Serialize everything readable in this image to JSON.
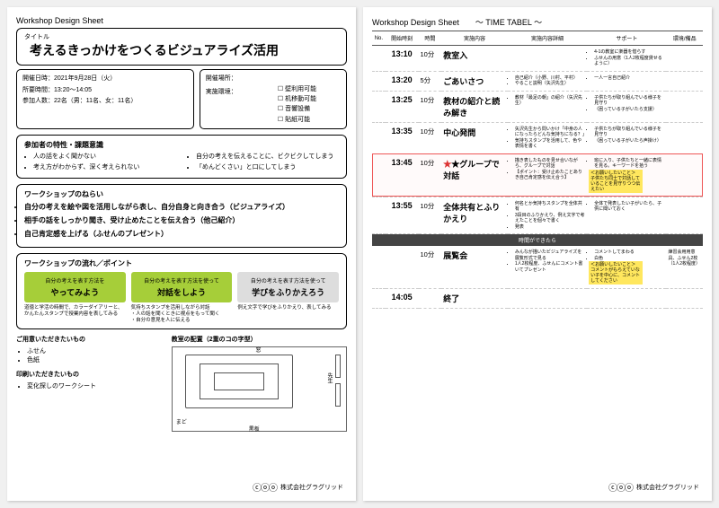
{
  "left": {
    "header": "Workshop Design Sheet",
    "title_label": "タイトル",
    "title": "考えるきっかけをつくるビジュアライズ活用",
    "meta": {
      "date_label": "開催日時：",
      "date": "2021年9月28日（火）",
      "duration_label": "所要時間：",
      "duration": "13:20～14:05",
      "count_label": "参加人数：",
      "count": "22名（男：11名、女：11名）",
      "place_label": "開催場所：",
      "env_label": "実施環境：",
      "env": [
        "壁利用可能",
        "机移動可能",
        "音響設備",
        "貼紙可能"
      ]
    },
    "sect1_title": "参加者の特性・課題意識",
    "sect1_left": [
      "人の話をよく聞かない",
      "考え方がわからず、深く考えられない"
    ],
    "sect1_right": [
      "自分の考えを伝えることに、ビクビクしてしまう",
      "「めんどくさい」と口にしてしまう"
    ],
    "sect2_title": "ワークショップのねらい",
    "sect2": [
      "自分の考えを絵や図を活用しながら表し、自分自身と向き合う（ビジュアライズ）",
      "相手の話をしっかり聞き、受け止めたことを伝え合う（他己紹介）",
      "自己肯定感を上げる（ふせんのプレゼント）"
    ],
    "sect3_title": "ワークショップの流れ／ポイント",
    "flow": [
      {
        "small": "自分の考えを表す方法を",
        "big": "やってみよう"
      },
      {
        "small": "自分の考えを表す方法を使って",
        "big": "対話をしよう"
      },
      {
        "small": "自分の考えを表す方法を使って",
        "big": "学びをふりかえろう"
      }
    ],
    "flow_notes": [
      "道徳と学活の時間で、カラーダイアリーと、かんたんスタンプで授業内容を表してみる",
      "気持ちスタンプを活用しながら対話\n・人の話を聞くときに視点をもって聞く\n・自分の意見を人に伝える",
      "例え文字で学びをふりかえり、表してみる"
    ],
    "supply_title": "ご用意いただきたいもの",
    "supply": [
      "ふせん",
      "色紙"
    ],
    "print_title": "印刷いただきたいもの",
    "print": [
      "変化探しのワークシート"
    ],
    "layout_title": "教室の配置（2重のコの字型）",
    "layout_labels": {
      "window": "窓",
      "teacher": "先生",
      "board": "黒板",
      "door": "まど"
    },
    "footer_cc": "ⓒⓞⓞ",
    "footer_company": "株式会社グラグリッド"
  },
  "right": {
    "header": "Workshop Design Sheet　　～ TIME TABEL ～",
    "cols": [
      "No.",
      "開始時刻",
      "時間",
      "実施内容",
      "実施内容詳細",
      "サポート",
      "環境/備品"
    ],
    "rows": [
      {
        "t": "13:10",
        "d": "10分",
        "c": "教室入",
        "det": "",
        "sup": [
          "4-1の教室に楽器を借らす",
          "ふせんの用意（1人2枚程度貸せるように）"
        ],
        "env": ""
      },
      {
        "t": "13:20",
        "d": "5分",
        "c": "ごあいさつ",
        "det": [
          "自己紹介（小野、川村、平村）",
          "やること説明（矢沢先生）"
        ],
        "sup": [
          "一人一言自己紹介"
        ],
        "env": ""
      },
      {
        "t": "13:25",
        "d": "10分",
        "c": "教材の紹介と読み解き",
        "det": [
          "教材「最足の朝」の紹介（矢沢先生）"
        ],
        "sup": [
          "子供たちが取り組んでいる様子を見守り",
          "（困っている子がいたら支援）"
        ],
        "env": ""
      },
      {
        "t": "13:35",
        "d": "10分",
        "c": "中心発問",
        "det": [
          "矢沢先生から問いかけ「中身の人になったらどんな気持ちになる？」",
          "気持ちスタンプを活用して、色や表情を書く"
        ],
        "sup": [
          "子供たちが取り組んでいる様子を見守り",
          "（困っている子がいたら声掛け）"
        ],
        "env": ""
      },
      {
        "t": "13:45",
        "d": "10分",
        "c": "★グループで対話",
        "star": true,
        "det": [
          "描き表したものを見せ合いながら、グループで対話",
          "【ポイント：受け止めたことありき自己肯定感を伝え合う】"
        ],
        "sup": [
          "班に入り、子供たちと一緒に表情を見る。キーワードを拾う"
        ],
        "note": "＜お願いしたいこと＞\n子供たち同士で対話していることを見守りつつ伝えたい",
        "env": ""
      },
      {
        "t": "13:55",
        "d": "10分",
        "c": "全体共有とふりかえり",
        "det": [
          "何名とか気持ちスタンプを全体共有",
          "3段目のふりかえり、例え文字で考えたことを個々で書く",
          "発表"
        ],
        "sup": [
          "全体で発表したい子がいたら、子供に聞いておく"
        ],
        "env": ""
      }
    ],
    "optional_title": "時間ができたら",
    "optional_rows": [
      {
        "t": "",
        "d": "10分",
        "c": "展覧会",
        "det": [
          "みんなが描いたビジュアライズを展覧形式で見る",
          "1人2枚程度、ふせんにコメント書いてプレゼント"
        ],
        "sup": [
          "コメントしてまわる",
          "白色"
        ],
        "note": "＜お願いしたいこと＞\nコメントがもらえていない子を中心に、コメントしてください",
        "env": "練習会用用意具、ふせん2枚（1人2枚程度）"
      },
      {
        "t": "14:05",
        "d": "",
        "c": "終了",
        "det": "",
        "sup": "",
        "env": ""
      }
    ],
    "footer_company": "株式会社グラグリッド"
  }
}
